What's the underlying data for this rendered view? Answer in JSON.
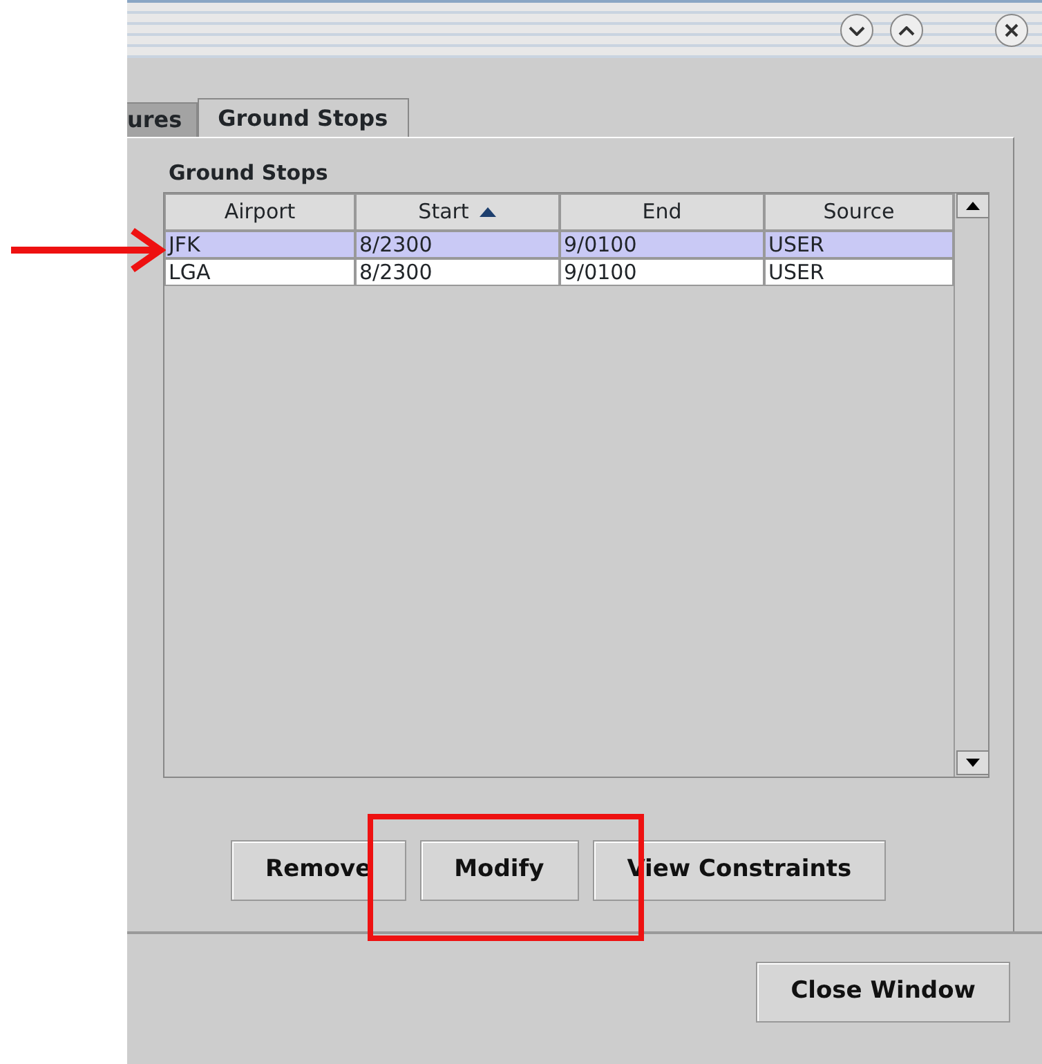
{
  "window": {
    "controls": [
      {
        "kind": "minimize"
      },
      {
        "kind": "maximize"
      },
      {
        "kind": "close"
      }
    ]
  },
  "tabs": [
    {
      "label": "ures",
      "selected": false
    },
    {
      "label": "Ground Stops",
      "selected": true
    }
  ],
  "group": {
    "title": "Ground Stops"
  },
  "table": {
    "columns": [
      {
        "label": "Airport",
        "sorted": false
      },
      {
        "label": "Start",
        "sorted": true
      },
      {
        "label": "End",
        "sorted": false
      },
      {
        "label": "Source",
        "sorted": false
      }
    ],
    "rows": [
      {
        "cells": [
          "JFK",
          "8/2300",
          "9/0100",
          "USER"
        ],
        "selected": true
      },
      {
        "cells": [
          "LGA",
          "8/2300",
          "9/0100",
          "USER"
        ],
        "selected": false
      }
    ]
  },
  "buttons": [
    "Remove",
    "Modify",
    "View Constraints"
  ],
  "footer_buttons": [
    "Close Window"
  ],
  "annotations": {
    "arrow": true,
    "rectangle": true
  }
}
